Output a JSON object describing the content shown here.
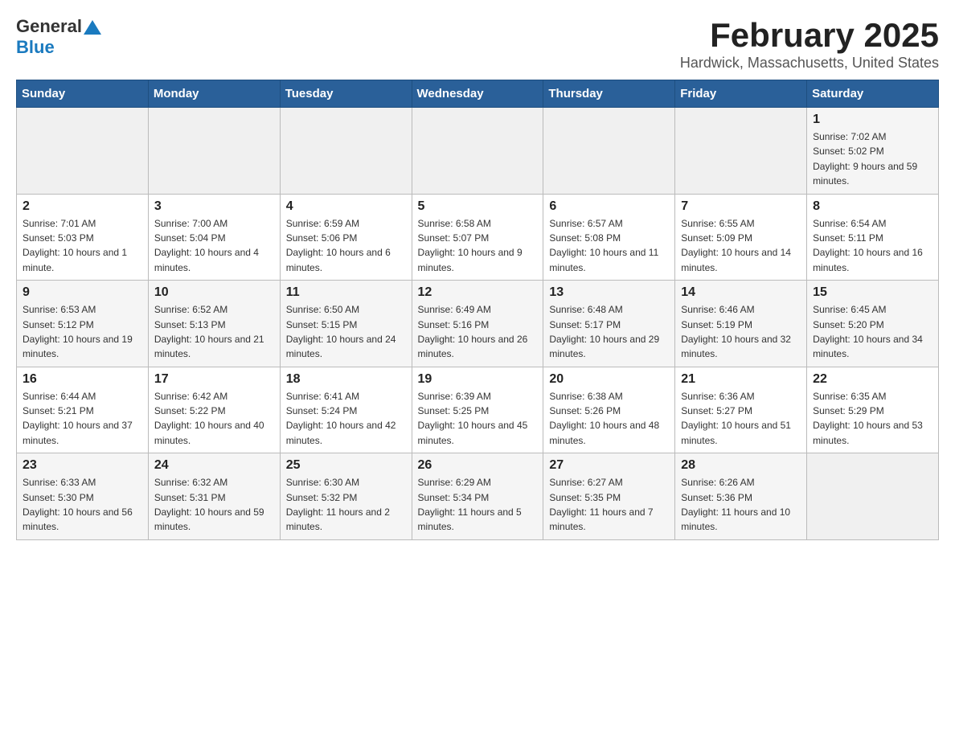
{
  "header": {
    "logo_general": "General",
    "logo_blue": "Blue",
    "month_title": "February 2025",
    "location": "Hardwick, Massachusetts, United States"
  },
  "weekdays": [
    "Sunday",
    "Monday",
    "Tuesday",
    "Wednesday",
    "Thursday",
    "Friday",
    "Saturday"
  ],
  "weeks": [
    [
      {
        "day": "",
        "info": ""
      },
      {
        "day": "",
        "info": ""
      },
      {
        "day": "",
        "info": ""
      },
      {
        "day": "",
        "info": ""
      },
      {
        "day": "",
        "info": ""
      },
      {
        "day": "",
        "info": ""
      },
      {
        "day": "1",
        "info": "Sunrise: 7:02 AM\nSunset: 5:02 PM\nDaylight: 9 hours and 59 minutes."
      }
    ],
    [
      {
        "day": "2",
        "info": "Sunrise: 7:01 AM\nSunset: 5:03 PM\nDaylight: 10 hours and 1 minute."
      },
      {
        "day": "3",
        "info": "Sunrise: 7:00 AM\nSunset: 5:04 PM\nDaylight: 10 hours and 4 minutes."
      },
      {
        "day": "4",
        "info": "Sunrise: 6:59 AM\nSunset: 5:06 PM\nDaylight: 10 hours and 6 minutes."
      },
      {
        "day": "5",
        "info": "Sunrise: 6:58 AM\nSunset: 5:07 PM\nDaylight: 10 hours and 9 minutes."
      },
      {
        "day": "6",
        "info": "Sunrise: 6:57 AM\nSunset: 5:08 PM\nDaylight: 10 hours and 11 minutes."
      },
      {
        "day": "7",
        "info": "Sunrise: 6:55 AM\nSunset: 5:09 PM\nDaylight: 10 hours and 14 minutes."
      },
      {
        "day": "8",
        "info": "Sunrise: 6:54 AM\nSunset: 5:11 PM\nDaylight: 10 hours and 16 minutes."
      }
    ],
    [
      {
        "day": "9",
        "info": "Sunrise: 6:53 AM\nSunset: 5:12 PM\nDaylight: 10 hours and 19 minutes."
      },
      {
        "day": "10",
        "info": "Sunrise: 6:52 AM\nSunset: 5:13 PM\nDaylight: 10 hours and 21 minutes."
      },
      {
        "day": "11",
        "info": "Sunrise: 6:50 AM\nSunset: 5:15 PM\nDaylight: 10 hours and 24 minutes."
      },
      {
        "day": "12",
        "info": "Sunrise: 6:49 AM\nSunset: 5:16 PM\nDaylight: 10 hours and 26 minutes."
      },
      {
        "day": "13",
        "info": "Sunrise: 6:48 AM\nSunset: 5:17 PM\nDaylight: 10 hours and 29 minutes."
      },
      {
        "day": "14",
        "info": "Sunrise: 6:46 AM\nSunset: 5:19 PM\nDaylight: 10 hours and 32 minutes."
      },
      {
        "day": "15",
        "info": "Sunrise: 6:45 AM\nSunset: 5:20 PM\nDaylight: 10 hours and 34 minutes."
      }
    ],
    [
      {
        "day": "16",
        "info": "Sunrise: 6:44 AM\nSunset: 5:21 PM\nDaylight: 10 hours and 37 minutes."
      },
      {
        "day": "17",
        "info": "Sunrise: 6:42 AM\nSunset: 5:22 PM\nDaylight: 10 hours and 40 minutes."
      },
      {
        "day": "18",
        "info": "Sunrise: 6:41 AM\nSunset: 5:24 PM\nDaylight: 10 hours and 42 minutes."
      },
      {
        "day": "19",
        "info": "Sunrise: 6:39 AM\nSunset: 5:25 PM\nDaylight: 10 hours and 45 minutes."
      },
      {
        "day": "20",
        "info": "Sunrise: 6:38 AM\nSunset: 5:26 PM\nDaylight: 10 hours and 48 minutes."
      },
      {
        "day": "21",
        "info": "Sunrise: 6:36 AM\nSunset: 5:27 PM\nDaylight: 10 hours and 51 minutes."
      },
      {
        "day": "22",
        "info": "Sunrise: 6:35 AM\nSunset: 5:29 PM\nDaylight: 10 hours and 53 minutes."
      }
    ],
    [
      {
        "day": "23",
        "info": "Sunrise: 6:33 AM\nSunset: 5:30 PM\nDaylight: 10 hours and 56 minutes."
      },
      {
        "day": "24",
        "info": "Sunrise: 6:32 AM\nSunset: 5:31 PM\nDaylight: 10 hours and 59 minutes."
      },
      {
        "day": "25",
        "info": "Sunrise: 6:30 AM\nSunset: 5:32 PM\nDaylight: 11 hours and 2 minutes."
      },
      {
        "day": "26",
        "info": "Sunrise: 6:29 AM\nSunset: 5:34 PM\nDaylight: 11 hours and 5 minutes."
      },
      {
        "day": "27",
        "info": "Sunrise: 6:27 AM\nSunset: 5:35 PM\nDaylight: 11 hours and 7 minutes."
      },
      {
        "day": "28",
        "info": "Sunrise: 6:26 AM\nSunset: 5:36 PM\nDaylight: 11 hours and 10 minutes."
      },
      {
        "day": "",
        "info": ""
      }
    ]
  ]
}
